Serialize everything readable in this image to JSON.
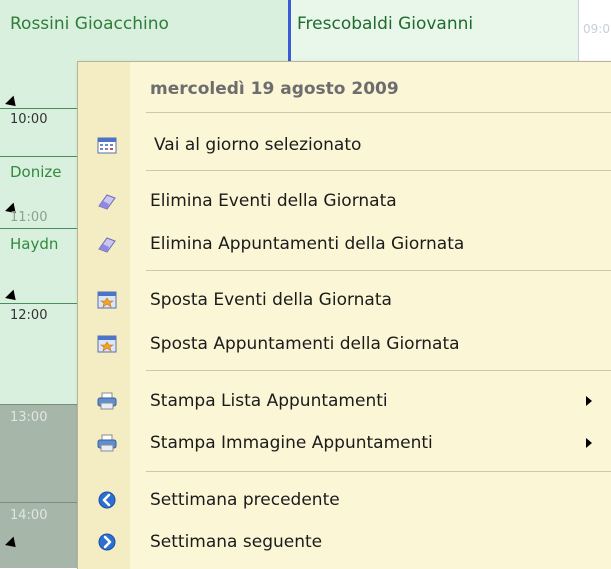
{
  "calendar": {
    "resources": [
      "Rossini Gioacchino",
      "Frescobaldi Giovanni"
    ],
    "right_column_time": "09:0",
    "times": [
      "10:00",
      "11:00",
      "12:00",
      "13:00",
      "14:00"
    ],
    "appointments": [
      "Donize",
      "Haydn"
    ]
  },
  "context_menu": {
    "header": "mercoledì 19 agosto 2009",
    "items": [
      {
        "label": "Vai al giorno selezionato",
        "icon": "calendar-icon"
      },
      {
        "label": "Elimina Eventi della Giornata",
        "icon": "eraser-icon"
      },
      {
        "label": "Elimina Appuntamenti della Giornata",
        "icon": "eraser-icon"
      },
      {
        "label": "Sposta Eventi della Giornata",
        "icon": "move-calendar-icon"
      },
      {
        "label": "Sposta Appuntamenti della Giornata",
        "icon": "move-calendar-icon"
      },
      {
        "label": "Stampa Lista Appuntamenti",
        "icon": "printer-icon",
        "submenu": true
      },
      {
        "label": "Stampa Immagine Appuntamenti",
        "icon": "printer-icon",
        "submenu": true
      },
      {
        "label": "Settimana precedente",
        "icon": "arrow-left-icon"
      },
      {
        "label": "Settimana seguente",
        "icon": "arrow-right-icon"
      }
    ]
  }
}
